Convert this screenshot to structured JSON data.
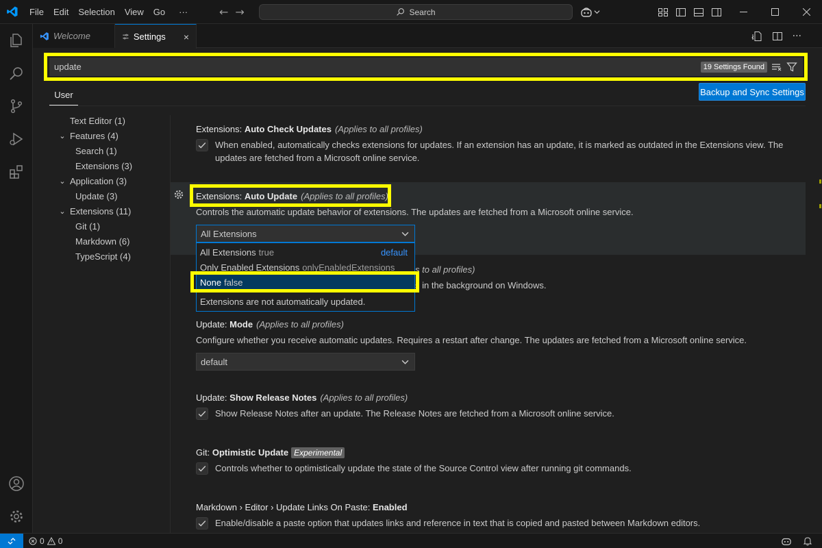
{
  "menu": [
    "File",
    "Edit",
    "Selection",
    "View",
    "Go"
  ],
  "menu_more": "···",
  "command_center": {
    "label": "Search"
  },
  "tabs": [
    {
      "label": "Welcome"
    },
    {
      "label": "Settings"
    }
  ],
  "tab_close": "×",
  "search": {
    "value": "update",
    "found": "19 Settings Found"
  },
  "scope_tab": "User",
  "sync_button": "Backup and Sync Settings",
  "toc": [
    {
      "label": "Text Editor (1)"
    },
    {
      "label": "Features (4)"
    },
    {
      "label": "Search (1)"
    },
    {
      "label": "Extensions (3)"
    },
    {
      "label": "Application (3)"
    },
    {
      "label": "Update (3)"
    },
    {
      "label": "Extensions (11)"
    },
    {
      "label": "Git (1)"
    },
    {
      "label": "Markdown (6)"
    },
    {
      "label": "TypeScript (4)"
    }
  ],
  "settings": {
    "auto_check": {
      "category": "Extensions: ",
      "name": "Auto Check Updates",
      "scope": "(Applies to all profiles)",
      "desc": "When enabled, automatically checks extensions for updates. If an extension has an update, it is marked as outdated in the Extensions view. The updates are fetched from a Microsoft online service."
    },
    "auto_update": {
      "category": "Extensions: ",
      "name": "Auto Update",
      "scope": "(Applies to all profiles)",
      "desc": "Controls the automatic update behavior of extensions. The updates are fetched from a Microsoft online service.",
      "selected": "All Extensions"
    },
    "hidden_scope_tail": "s to all profiles)",
    "hidden_desc_tail": "s in the background on Windows.",
    "mode": {
      "category": "Update: ",
      "name": "Mode",
      "scope": "(Applies to all profiles)",
      "desc": "Configure whether you receive automatic updates. Requires a restart after change. The updates are fetched from a Microsoft online service.",
      "selected": "default"
    },
    "release_notes": {
      "category": "Update: ",
      "name": "Show Release Notes",
      "scope": "(Applies to all profiles)",
      "desc": "Show Release Notes after an update. The Release Notes are fetched from a Microsoft online service."
    },
    "git_optimistic": {
      "category": "Git: ",
      "name": "Optimistic Update",
      "badge": "Experimental",
      "desc": "Controls whether to optimistically update the state of the Source Control view after running git commands."
    },
    "markdown_links": {
      "category": "Markdown › Editor › Update Links On Paste: ",
      "name": "Enabled",
      "desc": "Enable/disable a paste option that updates links and reference in text that is copied and pasted between Markdown editors."
    }
  },
  "dropdown": {
    "options": [
      {
        "label": "All Extensions",
        "value": "true",
        "default": "default"
      },
      {
        "label": "Only Enabled Extensions",
        "value": "onlyEnabledExtensions"
      },
      {
        "label": "None",
        "value": "false"
      }
    ],
    "description": "Extensions are not automatically updated."
  },
  "status": {
    "errors": "0",
    "warnings": "0"
  },
  "colors": {
    "accent": "#0078d4",
    "highlight": "#ffff00",
    "selected_option": "#04395e"
  }
}
